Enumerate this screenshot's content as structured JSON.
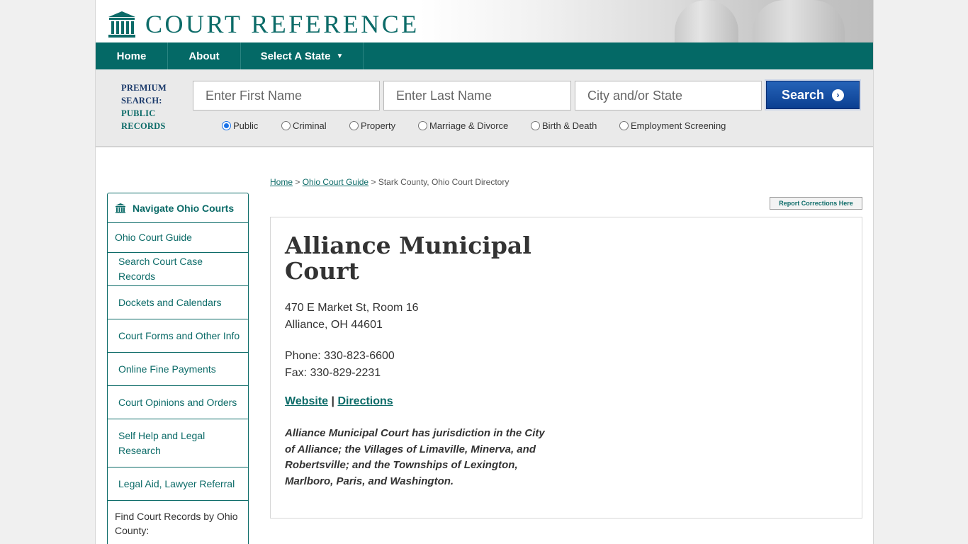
{
  "brand": {
    "name": "COURT REFERENCE"
  },
  "nav": {
    "home": "Home",
    "about": "About",
    "select_state": "Select A State"
  },
  "search": {
    "premium_line1": "PREMIUM",
    "premium_line2": "SEARCH:",
    "premium_line3": "PUBLIC",
    "premium_line4": "RECORDS",
    "first_name_placeholder": "Enter First Name",
    "last_name_placeholder": "Enter Last Name",
    "city_state_placeholder": "City and/or State",
    "button_label": "Search",
    "record_types": [
      "Public",
      "Criminal",
      "Property",
      "Marriage & Divorce",
      "Birth & Death",
      "Employment Screening"
    ],
    "selected_type": "Public"
  },
  "breadcrumb": {
    "home": "Home",
    "guide": "Ohio Court Guide",
    "current": "Stark County, Ohio Court Directory"
  },
  "report": {
    "label": "Report Corrections Here"
  },
  "sidebar": {
    "heading": "Navigate Ohio Courts",
    "guide": "Ohio Court Guide",
    "items": [
      "Search Court Case Records",
      "Dockets and Calendars",
      "Court Forms and Other Info",
      "Online Fine Payments",
      "Court Opinions and Orders",
      "Self Help and Legal Research",
      "Legal Aid, Lawyer Referral"
    ],
    "find_by_county": "Find Court Records by Ohio County:"
  },
  "court": {
    "name": "Alliance Municipal Court",
    "address_line1": "470 E Market St, Room 16",
    "address_line2": "Alliance, OH 44601",
    "phone": "Phone: 330-823-6600",
    "fax": "Fax: 330-829-2231",
    "website_label": "Website",
    "separator": "|",
    "directions_label": "Directions",
    "description": "Alliance Municipal Court has jurisdiction in the City of Alliance; the Villages of Limaville, Minerva, and Robertsville; and the Townships of Lexington, Marlboro, Paris, and Washington."
  },
  "colors": {
    "brand_teal": "#046966",
    "search_blue": "#0b3f91",
    "link_teal": "#0c6b68"
  }
}
